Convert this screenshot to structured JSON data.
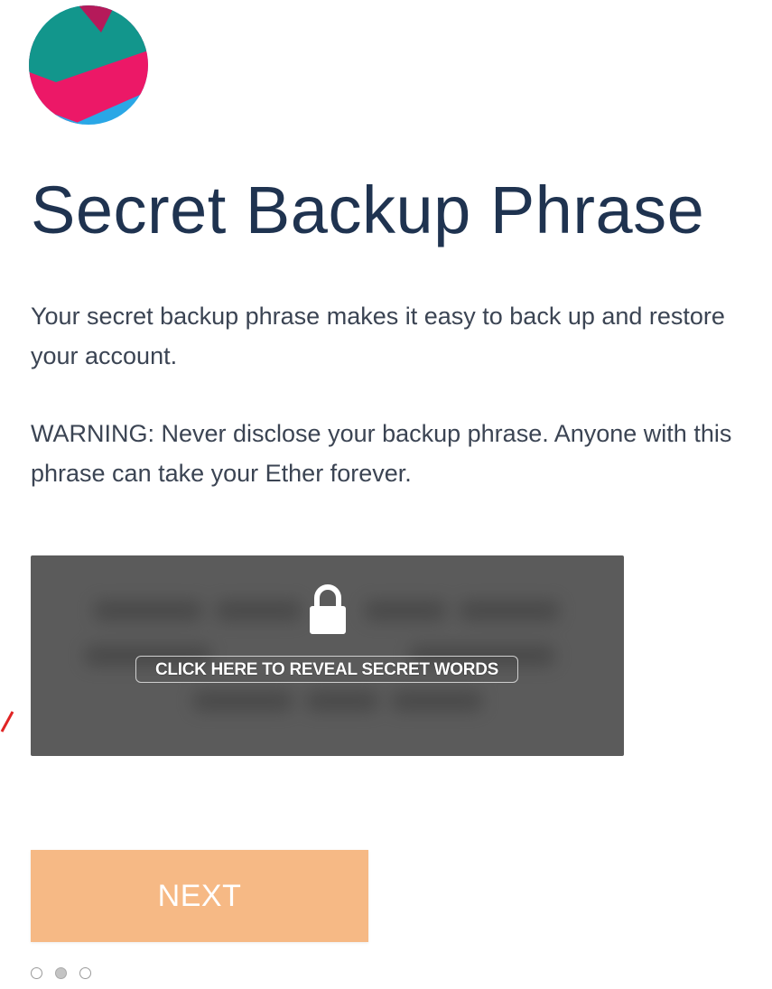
{
  "header": {
    "avatar": "identicon",
    "title": "Secret Backup Phrase"
  },
  "content": {
    "intro": "Your secret backup phrase makes it easy to back up and restore your account.",
    "warning": "WARNING: Never disclose your backup phrase. Anyone with this phrase can take your Ether forever."
  },
  "reveal": {
    "icon": "lock-icon",
    "label": "CLICK HERE TO REVEAL SECRET WORDS"
  },
  "actions": {
    "next_label": "NEXT"
  },
  "pager": {
    "total": 3,
    "active_index": 1
  },
  "colors": {
    "title": "#1f3350",
    "reveal_background": "#5b5b5b",
    "next_button": "#f6b985",
    "avatar_teal": "#12968c",
    "avatar_pink": "#ec1867",
    "avatar_blue": "#2aa7e6",
    "avatar_maroon": "#b51a5a"
  }
}
